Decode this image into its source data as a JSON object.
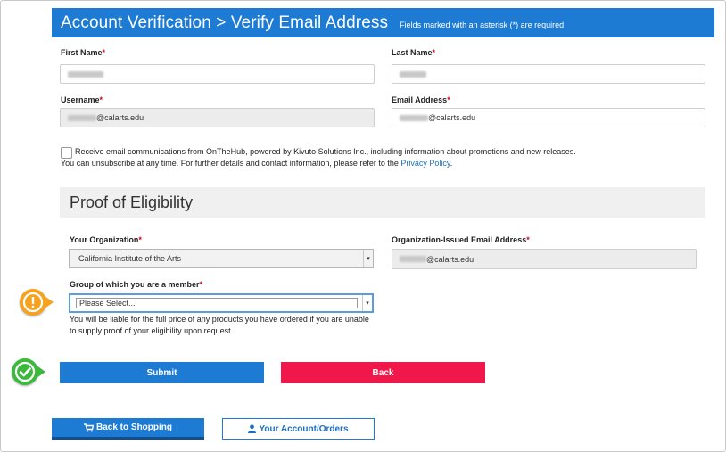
{
  "header": {
    "title": "Account Verification > Verify Email Address",
    "note": "Fields marked with an asterisk (*) are required"
  },
  "form": {
    "first_name_label": "First Name",
    "last_name_label": "Last Name",
    "username_label": "Username",
    "username_suffix": "@calarts.edu",
    "email_label": "Email Address",
    "email_suffix": "@calarts.edu",
    "required_mark": "*"
  },
  "consent": {
    "line1": "Receive email communications from OnTheHub, powered by Kivuto Solutions Inc., including information about promotions and new releases.",
    "line2_prefix": "You can unsubscribe at any time. For further details and contact information, please refer to the ",
    "privacy_link": "Privacy Policy",
    "line2_suffix": "."
  },
  "eligibility": {
    "section_title": "Proof of Eligibility",
    "org_label": "Your Organization",
    "org_value": "California Institute of the Arts",
    "org_email_label": "Organization-Issued Email Address",
    "org_email_suffix": "@calarts.edu",
    "group_label": "Group of which you are a member",
    "group_placeholder": "Please Select...",
    "liability_line1": "You will be liable for the full price of any products you have ordered if you are unable",
    "liability_line2": "to supply proof of your eligibility upon request"
  },
  "actions": {
    "submit_label": "Submit",
    "back_label": "Back",
    "back_to_shopping_label": "Back to Shopping",
    "account_orders_label": "Your Account/Orders"
  },
  "colors": {
    "header_blue": "#1e7bd4",
    "back_red": "#f0184b",
    "warning_orange": "#f6a21e",
    "success_green": "#3cb83c"
  }
}
